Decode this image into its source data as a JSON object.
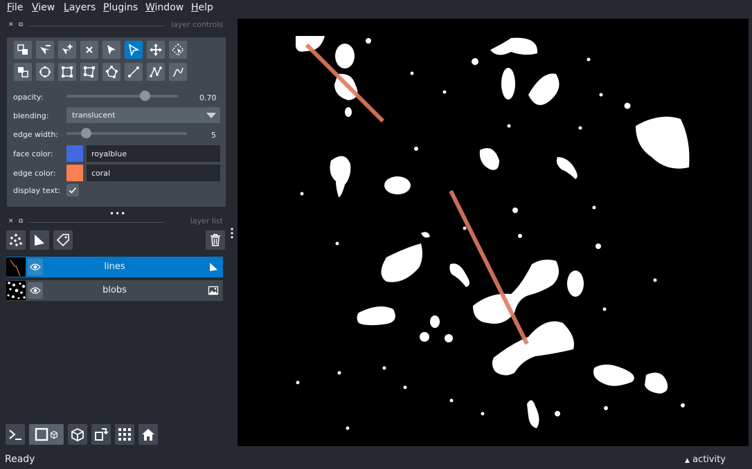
{
  "menu": [
    {
      "u": "F",
      "rest": "ile"
    },
    {
      "u": "V",
      "rest": "iew"
    },
    {
      "u": "L",
      "rest": "ayers"
    },
    {
      "u": "P",
      "rest": "lugins"
    },
    {
      "u": "W",
      "rest": "indow"
    },
    {
      "u": "H",
      "rest": "elp"
    }
  ],
  "layer_controls": {
    "title": "layer controls",
    "opacity_label": "opacity:",
    "opacity_value": "0.70",
    "opacity": 0.7,
    "blending_label": "blending:",
    "blending_value": "translucent",
    "edge_width_label": "edge width:",
    "edge_width_value": "5",
    "edge_width_fraction": 0.16,
    "face_color_label": "face color:",
    "face_color_value": "royalblue",
    "face_color_hex": "#4169e1",
    "edge_color_label": "edge color:",
    "edge_color_value": "coral",
    "edge_color_hex": "#ff7f50",
    "display_text_label": "display text:",
    "display_text_checked": true
  },
  "layer_list": {
    "title": "layer list",
    "layers": [
      {
        "name": "lines",
        "selected": true,
        "type_icon": "shapes-icon"
      },
      {
        "name": "blobs",
        "selected": false,
        "type_icon": "image-icon"
      }
    ]
  },
  "status": {
    "text": "Ready",
    "activity": "activity"
  },
  "colors": {
    "bg": "#262930",
    "panel": "#414851",
    "button": "#5a626c",
    "accent": "#007acc",
    "line": "#e07a5f"
  }
}
